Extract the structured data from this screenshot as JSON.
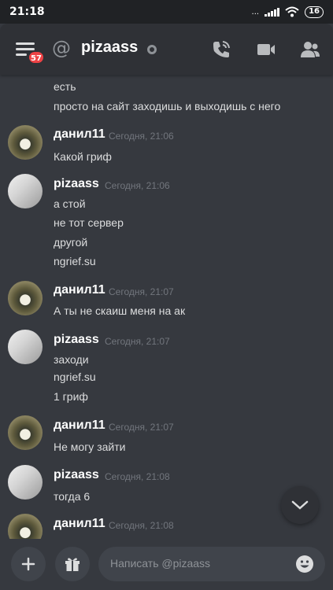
{
  "status_bar": {
    "time": "21:18",
    "battery": "16",
    "network_text": "..."
  },
  "header": {
    "menu_badge": "57",
    "at_symbol": "@",
    "channel_name": "pizaass",
    "status": "offline"
  },
  "messages": {
    "continued_lines": [
      "есть",
      "просто на сайт заходишь и выходишь с него"
    ],
    "groups": [
      {
        "author": "данил11",
        "timestamp": "Сегодня, 21:06",
        "lines": [
          "Какой гриф"
        ],
        "avatar": "danil"
      },
      {
        "author": "pizaass",
        "timestamp": "Сегодня, 21:06",
        "lines": [
          "а стой",
          "не тот сервер",
          "другой",
          "ngrief.su"
        ],
        "avatar": "piza"
      },
      {
        "author": "данил11",
        "timestamp": "Сегодня, 21:07",
        "lines": [
          "А ты не скаиш меня на ак"
        ],
        "avatar": "danil"
      },
      {
        "author": "pizaass",
        "timestamp": "Сегодня, 21:07",
        "lines": [
          "заходи",
          "ngrief.su",
          "1 гриф"
        ],
        "avatar": "piza"
      },
      {
        "author": "данил11",
        "timestamp": "Сегодня, 21:07",
        "lines": [
          "Не могу зайти"
        ],
        "avatar": "danil"
      },
      {
        "author": "pizaass",
        "timestamp": "Сегодня, 21:08",
        "lines": [
          "тогда 6"
        ],
        "avatar": "piza"
      },
      {
        "author": "данил11",
        "timestamp": "Сегодня, 21:08",
        "lines": [],
        "avatar": "danil"
      }
    ]
  },
  "composer": {
    "placeholder": "Написать @pizaass"
  },
  "icons": {
    "menu": "menu-icon",
    "call": "phone-call-icon",
    "video": "video-camera-icon",
    "members": "members-icon",
    "add": "plus-icon",
    "gift": "gift-icon",
    "emoji": "emoji-icon",
    "scroll": "chevron-down-icon"
  },
  "colors": {
    "background": "#36393f",
    "header": "#2f3136",
    "badge": "#ed4245",
    "timestamp": "#72767d"
  }
}
